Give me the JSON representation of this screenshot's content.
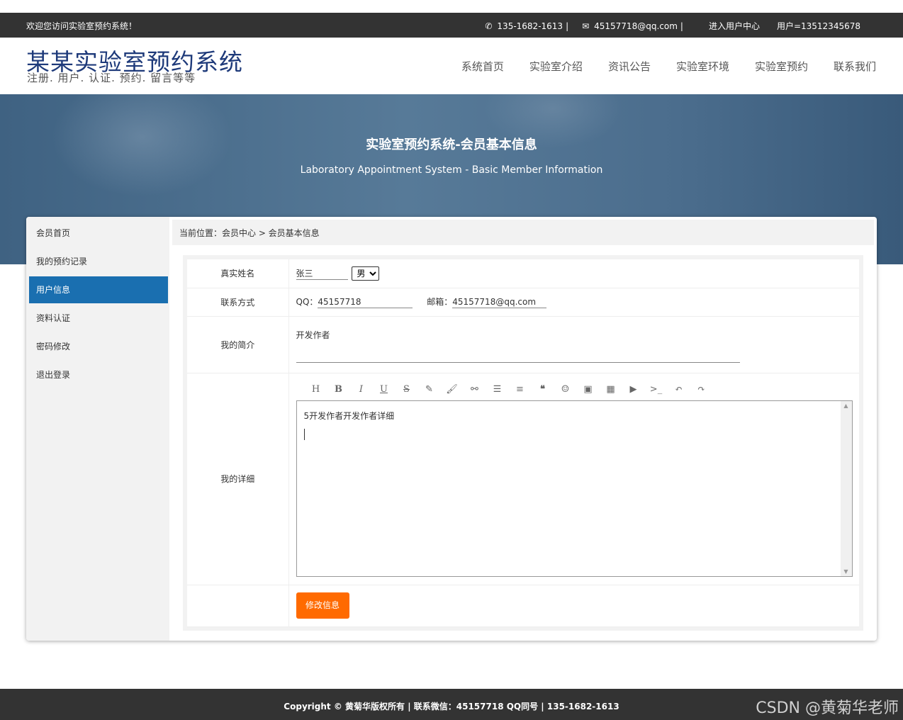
{
  "topbar": {
    "welcome": "欢迎您访问实验室预约系统！",
    "phone": "135-1682-1613",
    "email": "45157718@qq.com",
    "user_center": "进入用户中心",
    "user": "用户=13512345678",
    "separator": "|"
  },
  "header": {
    "title": "某某实验室预约系统",
    "subtitle": "注册. 用户. 认证. 预约. 留言等等",
    "nav": [
      "系统首页",
      "实验室介绍",
      "资讯公告",
      "实验室环境",
      "实验室预约",
      "联系我们"
    ]
  },
  "banner": {
    "title": "实验室预约系统-会员基本信息",
    "subtitle": "Laboratory Appointment System - Basic Member Information"
  },
  "sidebar": {
    "items": [
      "会员首页",
      "我的预约记录",
      "用户信息",
      "资料认证",
      "密码修改",
      "退出登录"
    ],
    "active_index": 2
  },
  "breadcrumb": "当前位置：会员中心 > 会员基本信息",
  "form": {
    "name_label": "真实姓名",
    "name_value": "张三",
    "gender_value": "男",
    "contact_label": "联系方式",
    "qq_label": "QQ：",
    "qq_value": "45157718",
    "email_label": "邮箱：",
    "email_value": "45157718@qq.com",
    "intro_label": "我的简介",
    "intro_value": "开发作者",
    "detail_label": "我的详细",
    "detail_value": "5开发作者开发作者详细",
    "submit_label": "修改信息"
  },
  "editor_toolbar": [
    "heading-icon",
    "bold-icon",
    "italic-icon",
    "underline-icon",
    "strikethrough-icon",
    "highlight-icon",
    "brush-icon",
    "link-icon",
    "bullet-list-icon",
    "align-icon",
    "quote-icon",
    "emoji-icon",
    "image-icon",
    "table-icon",
    "video-icon",
    "code-icon",
    "undo-icon",
    "redo-icon"
  ],
  "footer": {
    "copyright": "Copyright © 黄菊华版权所有 | 联系微信：45157718 QQ同号 | 135-1682-1613",
    "watermark": "CSDN @黄菊华老师"
  },
  "colors": {
    "topbar": "#333333",
    "title": "#1e3a7a",
    "active": "#1a6fb0",
    "button": "#ff6a00",
    "footer": "#333333"
  }
}
